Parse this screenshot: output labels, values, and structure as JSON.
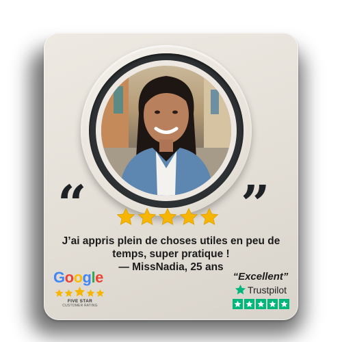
{
  "testimonial": {
    "line1": "J’ai appris plein de choses utiles en peu de",
    "line2": "temps, super pratique !",
    "author": "— MissNadia, 25 ans"
  },
  "rating": {
    "stars": 5,
    "star_color": "#f6b500"
  },
  "google": {
    "letters": [
      "G",
      "o",
      "o",
      "g",
      "l",
      "e"
    ],
    "label": "FIVE STAR",
    "sublabel": "CUSTOMER RATING"
  },
  "trustpilot": {
    "excellent": "“Excellent”",
    "brand": "Trustpilot",
    "color": "#00b67a"
  },
  "icons": [
    "open-quote-icon",
    "close-quote-icon",
    "star-icon",
    "trustpilot-star-icon"
  ]
}
